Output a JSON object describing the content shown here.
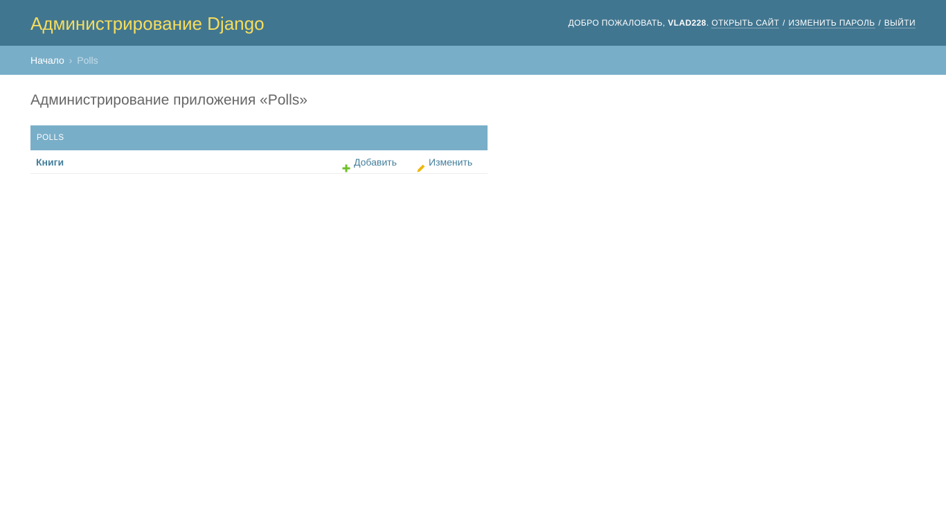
{
  "header": {
    "branding": "Администрирование Django",
    "welcome_text": "ДОБРО ПОЖАЛОВАТЬ,",
    "username": "VLAD228",
    "username_suffix": ".",
    "view_site": "ОТКРЫТЬ САЙТ",
    "separator": "/",
    "change_password": "ИЗМЕНИТЬ ПАРОЛЬ",
    "logout": "ВЫЙТИ"
  },
  "breadcrumbs": {
    "home": "Начало",
    "separator": "›",
    "current": "Polls"
  },
  "main": {
    "title": "Администрирование приложения «Polls»"
  },
  "app": {
    "caption": "Polls",
    "models": [
      {
        "name": "Книги",
        "add_label": "Добавить",
        "change_label": "Изменить"
      }
    ]
  },
  "icons": {
    "add": "plus-icon",
    "change": "pencil-icon"
  },
  "colors": {
    "header_bg": "#417690",
    "branding": "#f5dd5d",
    "breadcrumbs_bg": "#79aec8",
    "link": "#447e9b",
    "add_icon": "#70bf2b",
    "change_icon": "#efb80b"
  }
}
